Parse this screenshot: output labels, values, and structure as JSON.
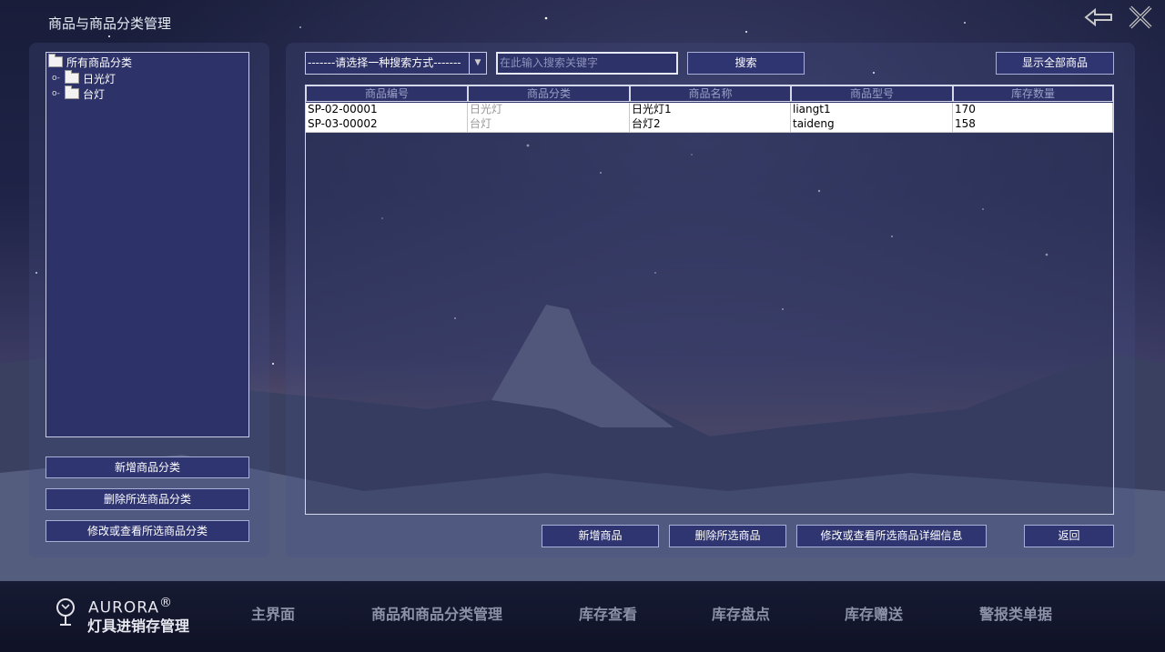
{
  "window": {
    "title": "商品与商品分类管理"
  },
  "tree": {
    "root": "所有商品分类",
    "children": [
      "日光灯",
      "台灯"
    ]
  },
  "left_buttons": {
    "add": "新增商品分类",
    "delete": "删除所选商品分类",
    "edit": "修改或查看所选商品分类"
  },
  "search": {
    "mode_selected": "-------请选择一种搜索方式-------",
    "placeholder": "在此输入搜索关键字",
    "search_label": "搜索",
    "show_all_label": "显示全部商品"
  },
  "table": {
    "columns": [
      "商品编号",
      "商品分类",
      "商品名称",
      "商品型号",
      "库存数量"
    ],
    "rows": [
      [
        "SP-02-00001",
        "日光灯",
        "日光灯1",
        "liangt1",
        "170"
      ],
      [
        "SP-03-00002",
        "台灯",
        "台灯2",
        "taideng",
        "158"
      ]
    ]
  },
  "bottom_buttons": {
    "add": "新增商品",
    "delete": "删除所选商品",
    "edit": "修改或查看所选商品详细信息",
    "back": "返回"
  },
  "footer": {
    "brand_en": "AURORA",
    "brand_reg": "®",
    "brand_cn": "灯具进销存管理",
    "nav": [
      "主界面",
      "商品和商品分类管理",
      "库存查看",
      "库存盘点",
      "库存赠送",
      "警报类单据"
    ]
  },
  "colors": {
    "panel": "#2d3268",
    "button": "#2f3570",
    "border": "#c9cde8"
  },
  "icons": {
    "back": "back-arrow-icon",
    "close": "close-icon",
    "logo": "lamp-logo-icon",
    "folder": "folder-icon"
  }
}
